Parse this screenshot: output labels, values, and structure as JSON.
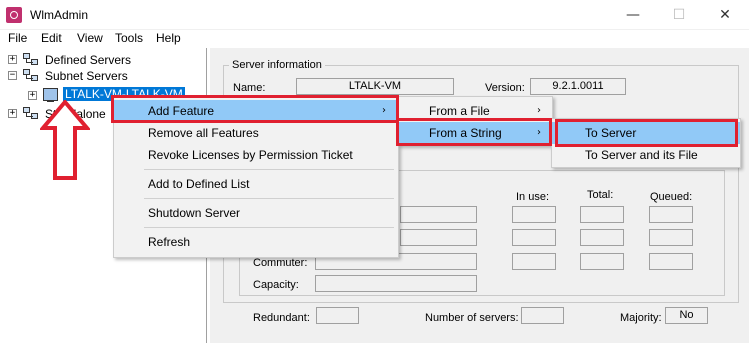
{
  "window": {
    "title": "WlmAdmin",
    "minimize": "—",
    "maximize": "☐",
    "close": "✕"
  },
  "menubar": [
    "File",
    "Edit",
    "View",
    "Tools",
    "Help"
  ],
  "tree": {
    "defined_servers": "Defined Servers",
    "subnet_servers": "Subnet Servers",
    "selected_server": "LTALK-VM-LTALK-VM",
    "standalone": "Standalone",
    "expander_plus": "+",
    "expander_minus": "−"
  },
  "server_info": {
    "group_title": "Server information",
    "name_label": "Name:",
    "name_value": "LTALK-VM",
    "version_label": "Version:",
    "version_value": "9.2.1.0011",
    "in_use_label": "In use:",
    "total_label": "Total:",
    "queued_label": "Queued:",
    "commuter_label": "Commuter:",
    "capacity_label": "Capacity:",
    "redundant_label": "Redundant:",
    "num_servers_label": "Number of servers:",
    "majority_label": "Majority:",
    "majority_value": "No"
  },
  "context_menu": {
    "items": [
      "Add Feature",
      "Remove all Features",
      "Revoke Licenses by Permission Ticket",
      "Add to Defined List",
      "Shutdown Server",
      "Refresh"
    ],
    "highlighted_index": 0
  },
  "submenu_add_feature": {
    "items": [
      "From a File",
      "From a String"
    ],
    "highlighted_index": 1
  },
  "submenu_from_string": {
    "items": [
      "To Server",
      "To Server and its File"
    ],
    "highlighted_index": 0
  },
  "submenu_arrow": "›",
  "colors": {
    "highlight": "#91c9f7",
    "annotation_red": "#e02030",
    "selection_blue": "#0078d7",
    "app_icon": "#c0306e"
  },
  "icons": [
    "app-icon",
    "network-servers-icon",
    "server-pc-icon",
    "submenu-arrow-icon",
    "annotation-up-arrow"
  ]
}
